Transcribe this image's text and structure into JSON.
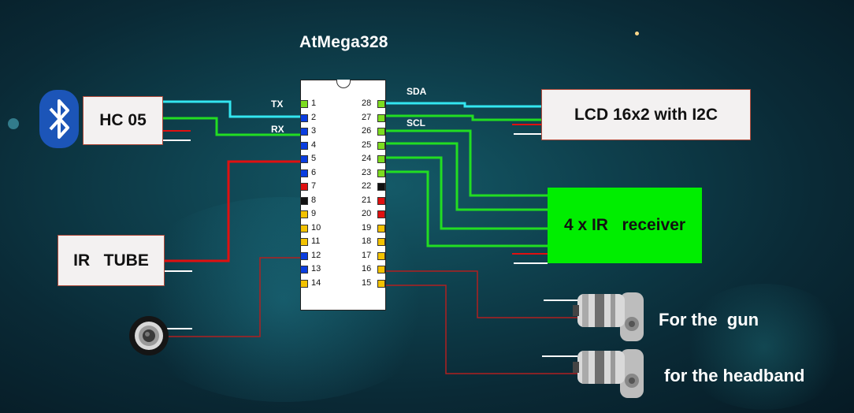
{
  "title": "AtMega328",
  "chip": {
    "left_pins": [
      "1",
      "2",
      "3",
      "4",
      "5",
      "6",
      "7",
      "8",
      "9",
      "10",
      "11",
      "12",
      "13",
      "14"
    ],
    "right_pins": [
      "28",
      "27",
      "26",
      "25",
      "24",
      "23",
      "22",
      "21",
      "20",
      "19",
      "18",
      "17",
      "16",
      "15"
    ],
    "left_colors": [
      "#7ddc1f",
      "#0a3de0",
      "#0a3de0",
      "#0a3de0",
      "#0a3de0",
      "#0a3de0",
      "#e01010",
      "#111111",
      "#f3c200",
      "#f3c200",
      "#f3c200",
      "#0a3de0",
      "#0a3de0",
      "#f3c200"
    ],
    "right_colors": [
      "#7ddc1f",
      "#7ddc1f",
      "#7ddc1f",
      "#7ddc1f",
      "#7ddc1f",
      "#7ddc1f",
      "#111111",
      "#e01010",
      "#e01010",
      "#f3c200",
      "#f3c200",
      "#f3c200",
      "#f3c200",
      "#f3c200"
    ]
  },
  "signals": {
    "tx": "TX",
    "rx": "RX",
    "sda": "SDA",
    "scl": "SCL"
  },
  "modules": {
    "hc05": "HC 05",
    "lcd": "LCD 16x2 with I2C",
    "ir_receiver": "4 x IR   receiver",
    "ir_tube": "IR   TUBE"
  },
  "captions": {
    "gun": "For the  gun",
    "headband": "for the headband"
  },
  "colors": {
    "tx_wire": "#33e6f0",
    "green_wire": "#22dd22",
    "red_wire": "#e01010",
    "dark_red_wire": "#b02020",
    "ir_box": "#00ee00"
  },
  "icons": {
    "bluetooth": "bluetooth-icon",
    "speaker": "speaker-icon",
    "motor": "dc-motor-icon"
  }
}
